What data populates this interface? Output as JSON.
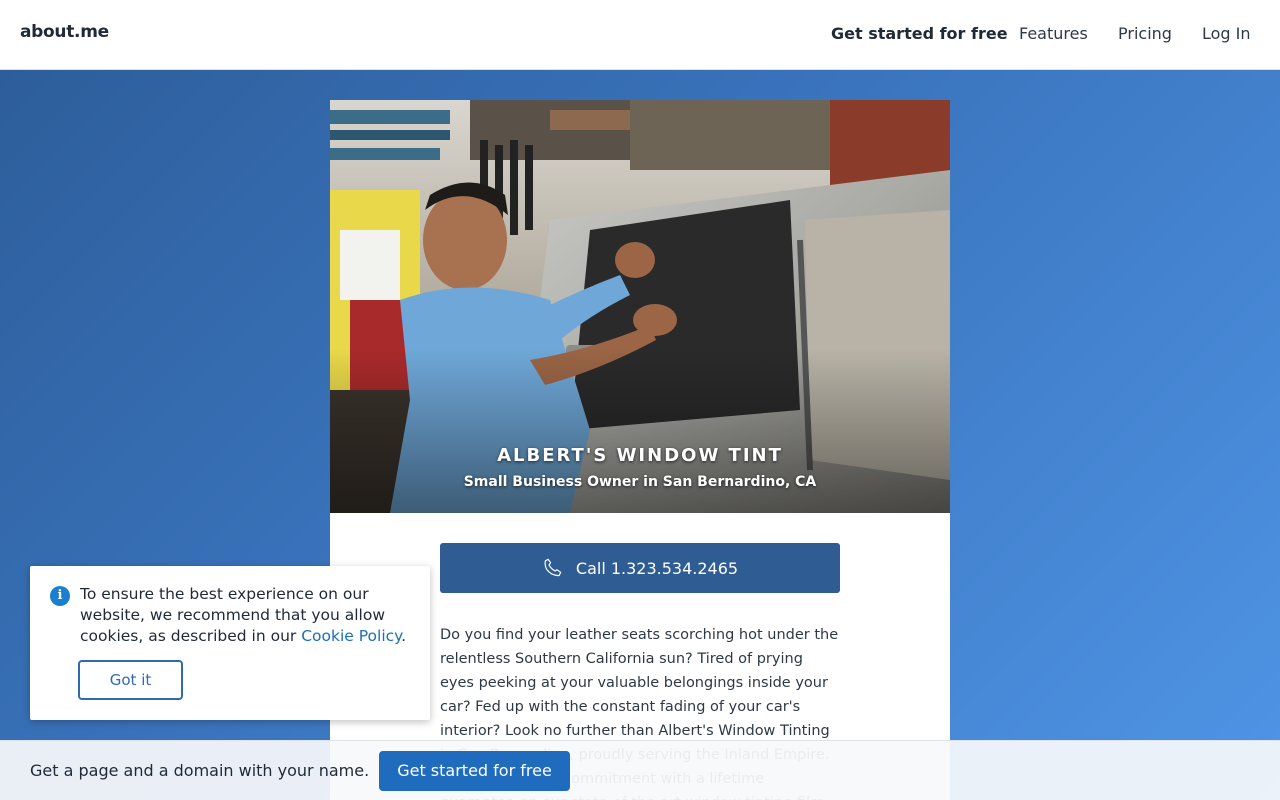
{
  "header": {
    "logo": "about.me",
    "nav": [
      {
        "label": "Get started for free"
      },
      {
        "label": "Features"
      },
      {
        "label": "Pricing"
      },
      {
        "label": "Log In"
      }
    ]
  },
  "profile": {
    "name": "ALBERT'S WINDOW TINT",
    "subtitle": "Small Business Owner in San Bernardino, CA",
    "call_label": "Call 1.323.534.2465",
    "bio": "Do you find your leather seats scorching hot under the relentless Southern California sun? Tired of prying eyes peeking at your valuable belongings inside your car? Fed up with the constant fading of your car's interior? Look no further than Albert's Window Tinting in San Bernardino, proudly serving the Inland Empire. We stand by our commitment with a lifetime guarantee on our state-of-the-art window tinting film. Whether you"
  },
  "cookie_banner": {
    "text": "To ensure the best experience on our website, we recommend that you allow cookies, as described in our",
    "link": "Cookie Policy",
    "suffix": ".",
    "button": "Got it"
  },
  "bottom_bar": {
    "text": "Get a page and a domain with your name.",
    "button": "Get started for free"
  },
  "colors": {
    "page_bg": "#3a74bd",
    "call_button": "#2e5c93",
    "cta_button": "#1f6bbd",
    "link": "#1a6fb8"
  }
}
